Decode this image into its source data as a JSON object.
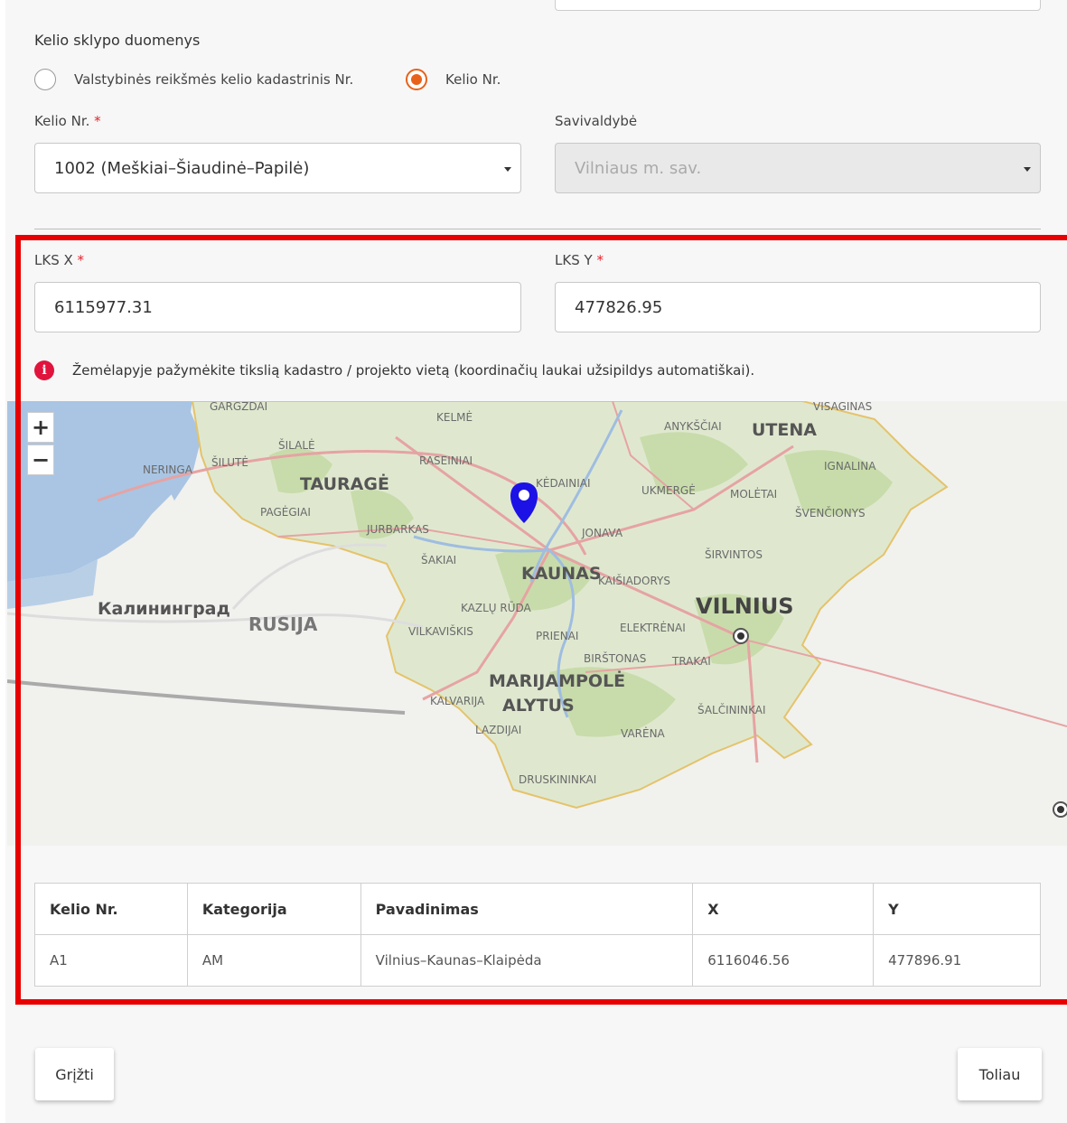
{
  "section": {
    "title": "Kelio sklypo duomenys"
  },
  "radios": [
    {
      "label": "Valstybinės reikšmės kelio kadastrinis Nr.",
      "checked": false
    },
    {
      "label": "Kelio Nr.",
      "checked": true
    }
  ],
  "road": {
    "label": "Kelio Nr.",
    "required": "*",
    "value": "1002 (Meškiai–Šiaudinė–Papilė)"
  },
  "municipality": {
    "label": "Savivaldybė",
    "value": "Vilniaus m. sav."
  },
  "lks_x": {
    "label": "LKS X",
    "required": "*",
    "value": "6115977.31"
  },
  "lks_y": {
    "label": "LKS Y",
    "required": "*",
    "value": "477826.95"
  },
  "info": {
    "icon": "info-icon",
    "text": "Žemėlapyje pažymėkite tikslią kadastro / projekto vietą (koordinačių laukai užsipildys automatiškai)."
  },
  "map": {
    "zoom_in": "+",
    "zoom_out": "−",
    "labels": {
      "gargzdai": "GARGŽDAI",
      "kelme": "KELMĖ",
      "anyksciai": "ANYKŠČIAI",
      "utena": "UTENA",
      "visaginas": "VISAGINAS",
      "silale": "ŠILALĖ",
      "neringa": "NERINGA",
      "silute": "ŠILUTĖ",
      "raseiniai": "RASEINIAI",
      "taurage": "TAURAGĖ",
      "kedainiai": "KĖDAINIAI",
      "ukmerge": "UKMERGĖ",
      "moletai": "MOLĖTAI",
      "ignalina": "IGNALINA",
      "pagegiai": "PAGĖGIAI",
      "jurbarkas": "JURBARKAS",
      "jonava": "JONAVA",
      "svencionys": "ŠVENČIONYS",
      "sakiai": "ŠAKIAI",
      "sirvintos": "ŠIRVINTOS",
      "kaunas": "KAUNAS",
      "kaisiadorys": "KAIŠIADORYS",
      "kaliningrad": "Калининград",
      "kazlu_ruda": "KAZLŲ RŪDA",
      "vilnius": "VILNIUS",
      "rusija": "RUSIJA",
      "vilkaviskis": "VILKAVIŠKIS",
      "prienai": "PRIENAI",
      "elektrenai": "ELEKTRĖNAI",
      "birstonas": "BIRŠTONAS",
      "trakai": "TRAKAI",
      "marijampole": "MARIJAMPOLĖ",
      "kalvarija": "KALVARIJA",
      "alytus": "ALYTUS",
      "salcininkai": "ŠALČININKAI",
      "lazdijai": "LAZDIJAI",
      "varena": "VARĖNA",
      "druskininkai": "DRUSKININKAI"
    }
  },
  "table": {
    "headers": [
      "Kelio Nr.",
      "Kategorija",
      "Pavadinimas",
      "X",
      "Y"
    ],
    "rows": [
      [
        "A1",
        "AM",
        "Vilnius–Kaunas–Klaipėda",
        "6116046.56",
        "477896.91"
      ]
    ]
  },
  "buttons": {
    "back": "Grįžti",
    "next": "Toliau"
  },
  "colors": {
    "accent": "#e8621a",
    "required": "#e8202a",
    "highlight": "#e80000",
    "marker": "#1c12e6"
  }
}
